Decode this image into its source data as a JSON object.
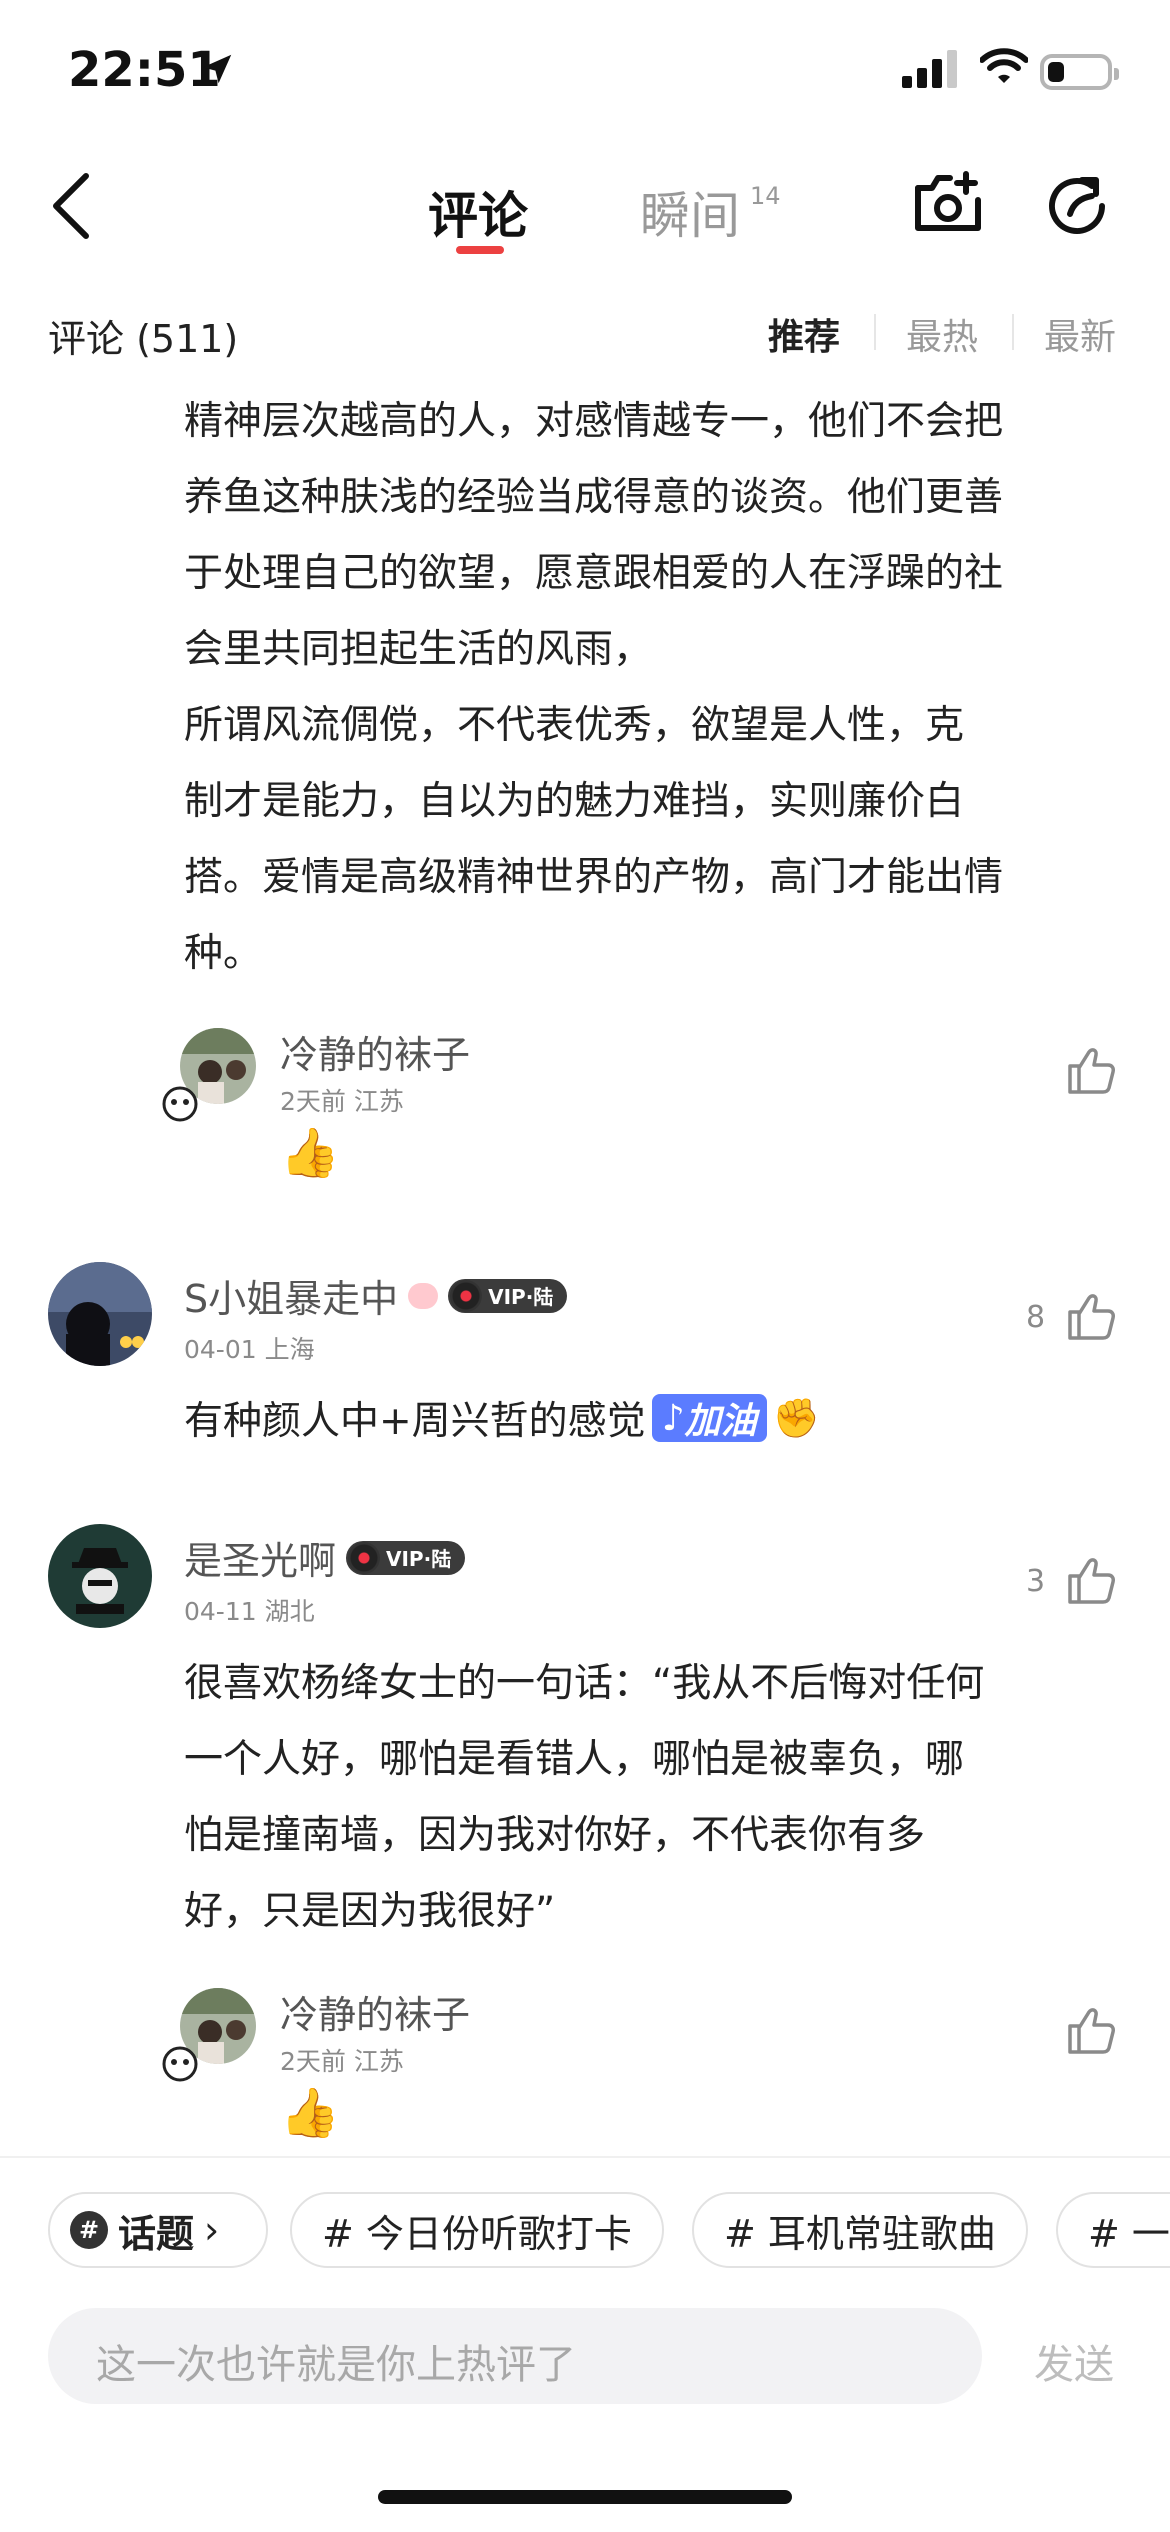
{
  "status_bar": {
    "time": "22:51"
  },
  "header": {
    "tabs": [
      {
        "label": "评论",
        "active": true
      },
      {
        "label": "瞬间",
        "count": "14",
        "active": false
      }
    ]
  },
  "comments_header": {
    "count_label": "评论 (511)",
    "sort_options": [
      "推荐",
      "最热",
      "最新"
    ],
    "active_sort": "推荐"
  },
  "comments": [
    {
      "text_lines": [
        "精神层次越高的人，对感情越专一，他们不会把",
        "养鱼这种肤浅的经验当成得意的谈资。他们更善",
        "于处理自己的欲望，愿意跟相爱的人在浮躁的社",
        "会里共同担起生活的风雨，",
        "所谓风流倜傥，不代表优秀，欲望是人性，克",
        "制才是能力，自以为的魅力难挡，实则廉价白",
        "搭。爱情是高级精神世界的产物，高门才能出情",
        "种。"
      ],
      "reply": {
        "nickname": "冷静的袜子",
        "meta": "2天前 江苏",
        "content_emoji": "👍"
      }
    },
    {
      "nickname": "S小姐暴走中",
      "vip": "VIP·陆",
      "meta": "04-01 上海",
      "like_count": "8",
      "text": "有种颜人中+周兴哲的感觉",
      "tag": "加油",
      "tag_emoji": "✊"
    },
    {
      "nickname": "是圣光啊",
      "vip": "VIP·陆",
      "meta": "04-11 湖北",
      "like_count": "3",
      "text_lines": [
        "很喜欢杨绛女士的一句话：“我从不后悔对任何",
        "一个人好，哪怕是看错人，哪怕是被辜负，哪",
        "怕是撞南墙，因为我对你好，不代表你有多",
        "好，只是因为我很好”"
      ],
      "reply": {
        "nickname": "冷静的袜子",
        "meta": "2天前 江苏",
        "content_emoji": "👍"
      }
    }
  ],
  "topics": {
    "main_label": "话题",
    "chips": [
      "# 今日份听歌打卡",
      "# 耳机常驻歌曲",
      "# 一"
    ]
  },
  "composer": {
    "placeholder": "这一次也许就是你上热评了",
    "send_label": "发送"
  },
  "colors": {
    "accent": "#ec4141",
    "tag_blue": "#5b7cff"
  }
}
